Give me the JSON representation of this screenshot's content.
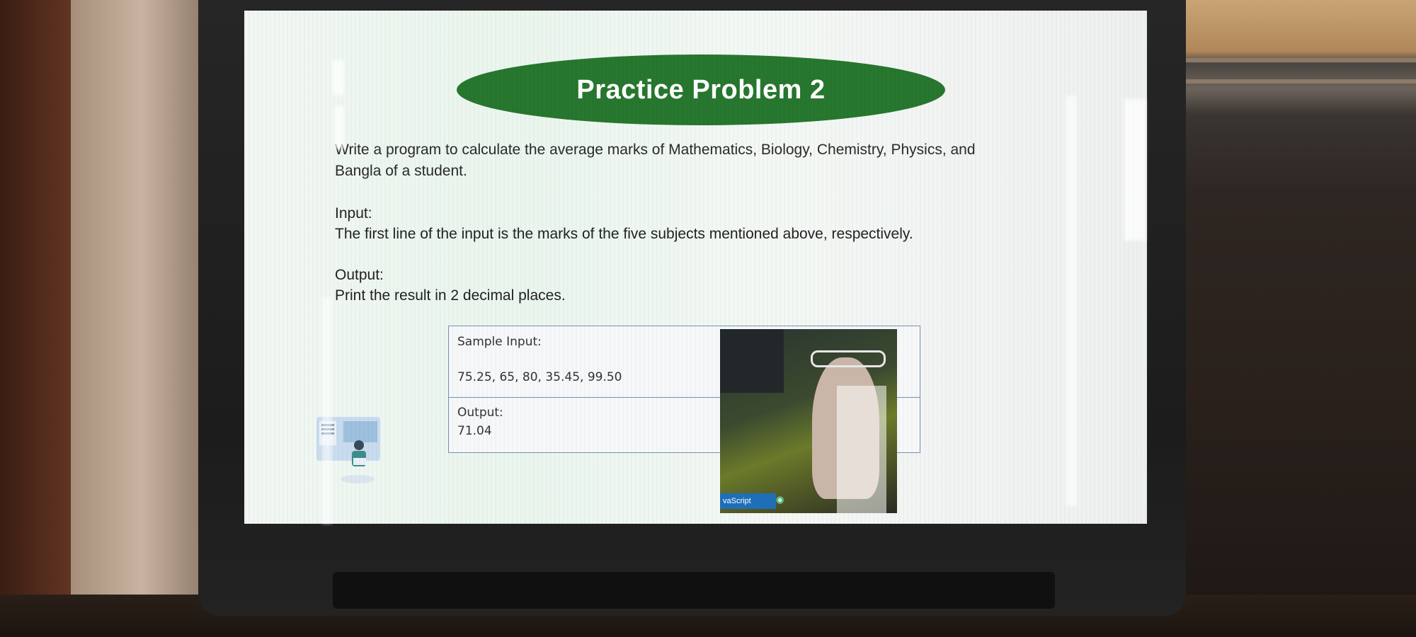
{
  "slide": {
    "title": "Practice Problem 2",
    "description_line1": "Write a program to calculate the average marks of Mathematics, Biology, Chemistry, Physics, and",
    "description_line2": "Bangla of a student.",
    "input_label": "Input:",
    "input_text": "The first line of the input is the marks of the five subjects mentioned above, respectively.",
    "output_label": "Output:",
    "output_text": "Print the result in 2 decimal places.",
    "sample": {
      "input_label": "Sample Input:",
      "input_value": "75.25, 65, 80, 35.45, 99.50",
      "output_label": "Output:",
      "output_value": "71.04"
    }
  },
  "webcam": {
    "tag": "vaScript"
  },
  "colors": {
    "title_blob": "#27772f",
    "table_border": "#7a93b0",
    "webcam_tag": "#1f6fb8"
  },
  "icons": [
    "person-with-laptop-illustration-icon",
    "video-icon"
  ]
}
